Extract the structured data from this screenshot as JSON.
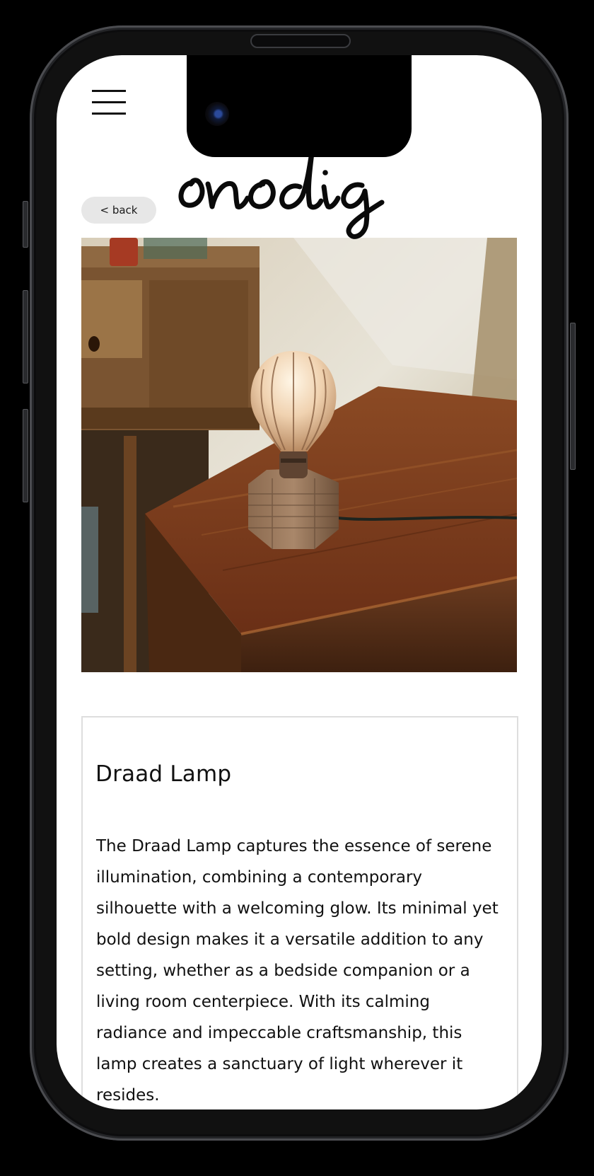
{
  "header": {
    "menu_icon": "hamburger-menu-icon",
    "brand": "onodig",
    "back_label": "< back"
  },
  "product": {
    "image_subject": "lamp-photo",
    "title": "Draad Lamp",
    "description": "The Draad Lamp captures the essence of serene illumination, combining a contemporary silhouette with a welcoming glow. Its minimal yet bold design makes it a versatile addition to any setting, whether as a bedside companion or a living room centerpiece. With its calming radiance and impeccable craftsmanship, this lamp creates a sanctuary of light wherever it resides."
  },
  "colors": {
    "background": "#000000",
    "screen": "#ffffff",
    "back_button": "#e7e7e7",
    "text": "#111111",
    "card_border": "#dedede"
  }
}
